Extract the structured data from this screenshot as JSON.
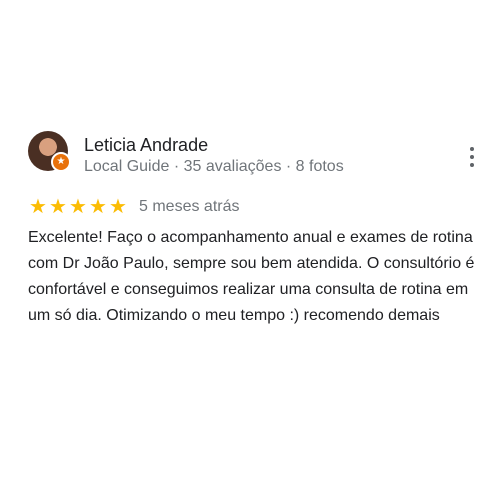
{
  "review": {
    "author_name": "Leticia Andrade",
    "author_meta": "Local Guide · 35 avaliações · 8 fotos",
    "badge_icon": "star-icon",
    "rating": 5,
    "rating_max": 5,
    "star_color": "#fbbc04",
    "date": "5 meses atrás",
    "text": "Excelente! Faço o acompanhamento anual e exames de rotina com Dr João Paulo, sempre sou bem atendida. O consultório é confortável e conseguimos realizar uma consulta de rotina em um só dia. Otimizando o meu tempo :) recomendo demais"
  }
}
